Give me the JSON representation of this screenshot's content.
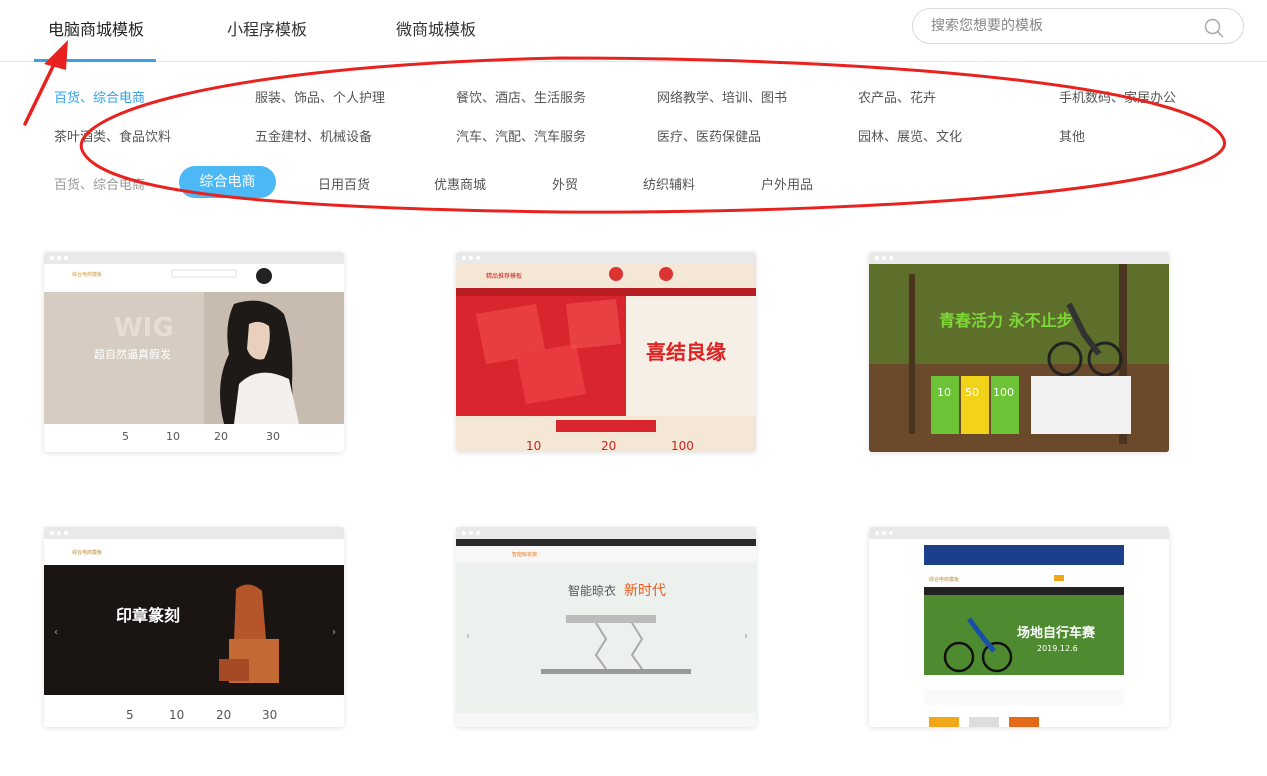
{
  "tabs": [
    {
      "label": "电脑商城模板",
      "active": true
    },
    {
      "label": "小程序模板",
      "active": false
    },
    {
      "label": "微商城模板",
      "active": false
    }
  ],
  "search": {
    "placeholder": "搜索您想要的模板"
  },
  "categories": [
    [
      "百货、综合电商",
      "服装、饰品、个人护理",
      "餐饮、酒店、生活服务",
      "网络教学、培训、图书",
      "农产品、花卉",
      "手机数码、家居办公"
    ],
    [
      "茶叶酒类、食品饮料",
      "五金建材、机械设备",
      "汽车、汽配、汽车服务",
      "医疗、医药保健品",
      "园林、展览、文化",
      "其他"
    ]
  ],
  "subcategories": {
    "current": "百货、综合电商",
    "selected": "综合电商",
    "items": [
      "日用百货",
      "优惠商城",
      "外贸",
      "纺织辅料",
      "户外用品"
    ]
  },
  "templates": {
    "t1": {
      "logo": "综合电商模板",
      "headline": "超自然逼真假发",
      "nums": [
        "5",
        "10",
        "20",
        "30"
      ]
    },
    "t2": {
      "logo": "精品推荐模板",
      "headline": "喜结良缘",
      "nums": [
        "10",
        "20",
        "100"
      ]
    },
    "t3": {
      "headline": "青春活力 永不止步",
      "nums": [
        "10",
        "50",
        "100"
      ]
    },
    "t4": {
      "logo": "综合电商模板",
      "headline": "印章篆刻",
      "nums": [
        "5",
        "10",
        "20",
        "30"
      ]
    },
    "t5": {
      "logo": "智能晾衣架",
      "headline": "智能晾衣",
      "highlight": "新时代"
    },
    "t6": {
      "logo": "综合电商模板",
      "headline": "场地自行车赛",
      "date": "2019.12.6"
    }
  },
  "colors": {
    "accent": "#2fa0ea",
    "pill": "#4cb8f5",
    "annotation": "#e8231f"
  },
  "icons": {
    "search": "search-icon",
    "arrow": "arrow-annotation-icon"
  }
}
